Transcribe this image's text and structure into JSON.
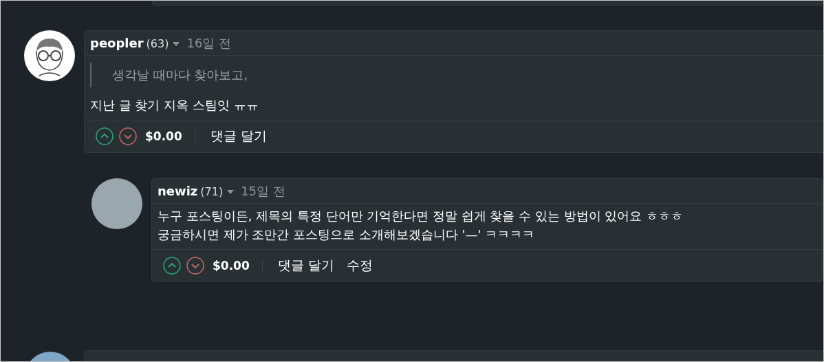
{
  "comments": [
    {
      "author": "peopler",
      "reputation": "(63)",
      "time": "16일 전",
      "quote": "생각날 때마다 찾아보고,",
      "body": [
        "지난 글 찾기 지옥 스팀잇 ㅠㅠ"
      ],
      "payout": "$0.00",
      "actions": [
        "댓글 달기"
      ],
      "children": [
        {
          "author": "newiz",
          "reputation": "(71)",
          "time": "15일 전",
          "body": [
            "누구 포스팅이든, 제목의 특정 단어만 기억한다면 정말 쉽게 찾을 수 있는 방법이 있어요 ㅎㅎㅎ",
            "궁금하시면 제가 조만간 포스팅으로 소개해보겠습니다 '—' ㅋㅋㅋㅋ"
          ],
          "payout": "$0.00",
          "actions": [
            "댓글 달기",
            "수정"
          ]
        }
      ]
    }
  ]
}
